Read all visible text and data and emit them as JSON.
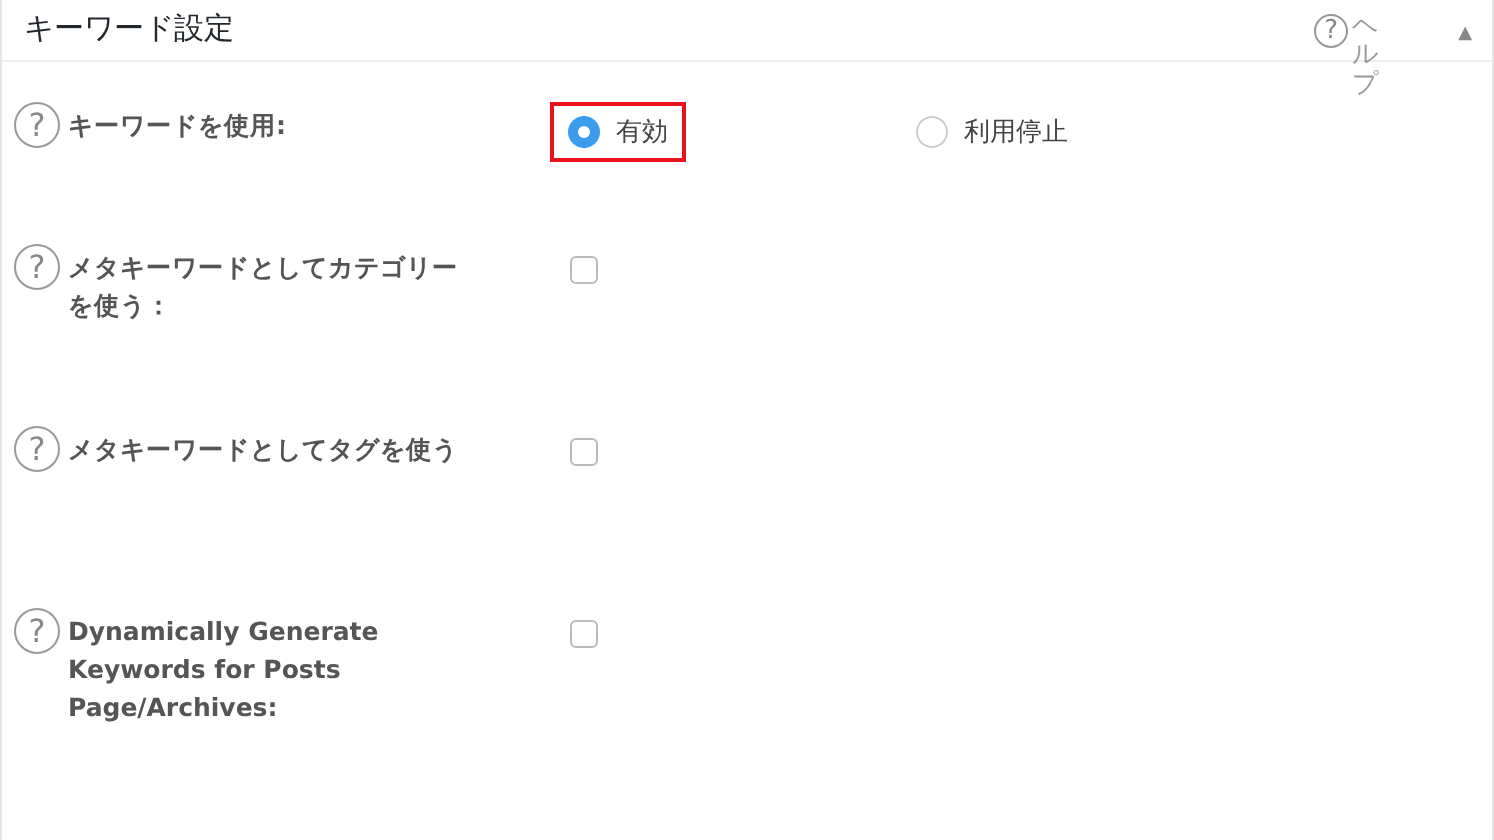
{
  "panel": {
    "title": "キーワード設定",
    "help": {
      "icon": "?",
      "label": "ヘルプ"
    },
    "toggle": "▲"
  },
  "settings": [
    {
      "kind": "radio",
      "help_icon": "?",
      "label": "キーワードを使用:",
      "options": [
        {
          "label": "有効",
          "selected": true,
          "color": "#e8121c"
        },
        {
          "label": "利用停止",
          "selected": false
        }
      ]
    },
    {
      "kind": "checkbox",
      "help_icon": "?",
      "label": "メタキーワードとしてカテゴリーを使う：",
      "checked": false
    },
    {
      "kind": "checkbox",
      "help_icon": "?",
      "label": "メタキーワードとしてタグを使う",
      "checked": false
    },
    {
      "kind": "checkbox",
      "help_icon": "?",
      "label": "Dynamically Generate Keywords for Posts Page/Archives:",
      "checked": false
    }
  ]
}
